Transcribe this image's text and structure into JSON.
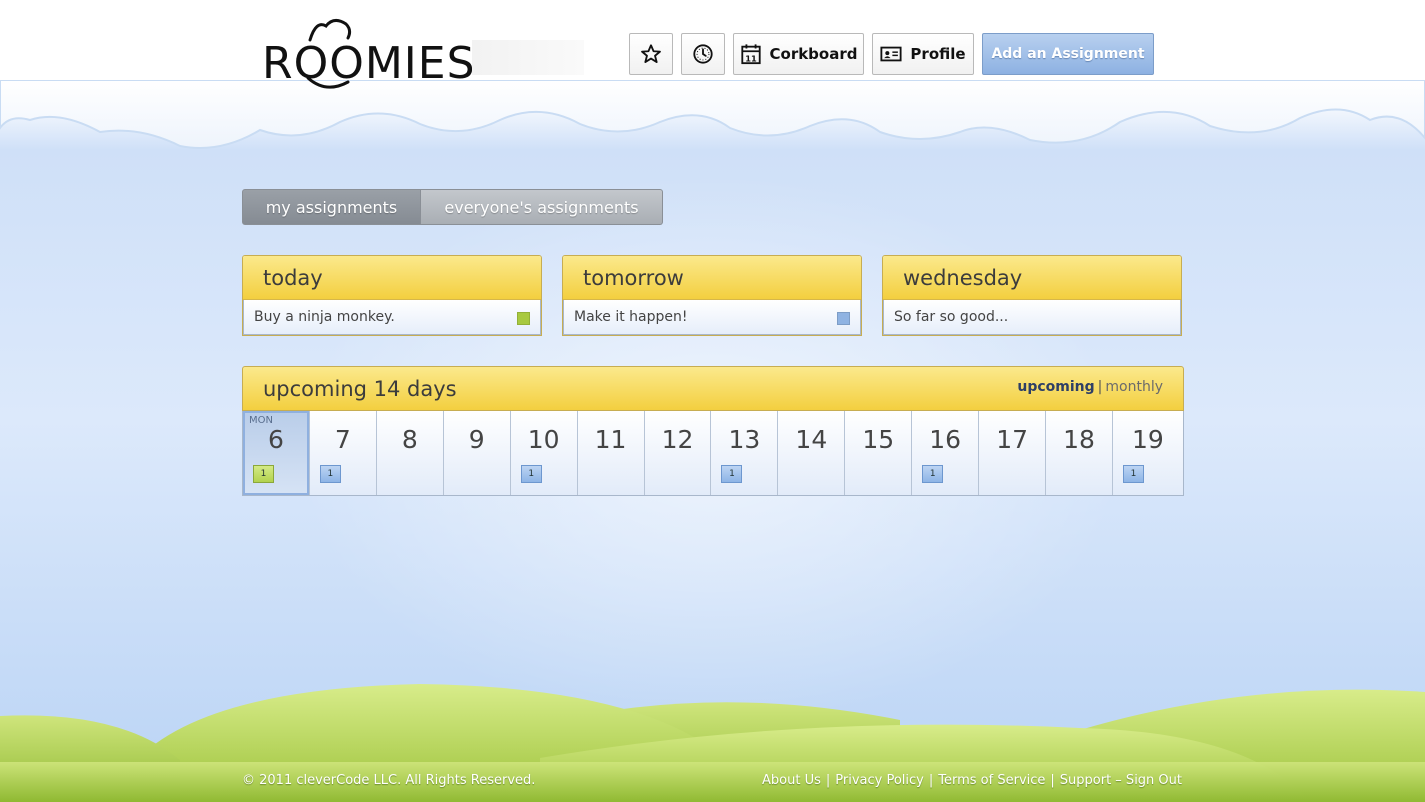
{
  "header": {
    "logo_text": "ROOMIES",
    "buttons": {
      "favorites_icon": "star-icon",
      "history_icon": "clock-icon",
      "corkboard_label": "Corkboard",
      "corkboard_icon": "calendar-icon",
      "corkboard_icon_text": "11",
      "profile_label": "Profile",
      "profile_icon": "id-card-icon"
    },
    "add_assignment_label": "Add an Assignment"
  },
  "tabs": [
    {
      "label": "my assignments",
      "active": true
    },
    {
      "label": "everyone's assignments",
      "active": false
    }
  ],
  "day_cards": [
    {
      "title": "today",
      "task": "Buy a ninja monkey.",
      "swatch": "#a8c93f"
    },
    {
      "title": "tomorrow",
      "task": "Make it happen!",
      "swatch": "#8fb3e2"
    },
    {
      "title": "wednesday",
      "task": "So far so good...",
      "swatch": null
    }
  ],
  "upcoming": {
    "title": "upcoming 14 days",
    "view_upcoming": "upcoming",
    "separator": "|",
    "view_monthly": "monthly",
    "days": [
      {
        "num": "6",
        "name": "MON",
        "count": "1",
        "color": "green",
        "today": true
      },
      {
        "num": "7",
        "count": "1",
        "color": "blue"
      },
      {
        "num": "8"
      },
      {
        "num": "9"
      },
      {
        "num": "10",
        "count": "1",
        "color": "blue"
      },
      {
        "num": "11"
      },
      {
        "num": "12"
      },
      {
        "num": "13",
        "count": "1",
        "color": "blue"
      },
      {
        "num": "14"
      },
      {
        "num": "15"
      },
      {
        "num": "16",
        "count": "1",
        "color": "blue"
      },
      {
        "num": "17"
      },
      {
        "num": "18"
      },
      {
        "num": "19",
        "count": "1",
        "color": "blue"
      }
    ]
  },
  "footer": {
    "copyright": "© 2011 cleverCode LLC. All Rights Reserved.",
    "links": [
      "About Us",
      "Privacy Policy",
      "Terms of Service",
      "Support – Sign Out"
    ],
    "separator": "|"
  },
  "colors": {
    "accent_yellow": "#f3cf3f",
    "sky_blue": "#cfe0f8",
    "grass_green": "#a8c93f",
    "button_blue": "#8db1e2"
  }
}
